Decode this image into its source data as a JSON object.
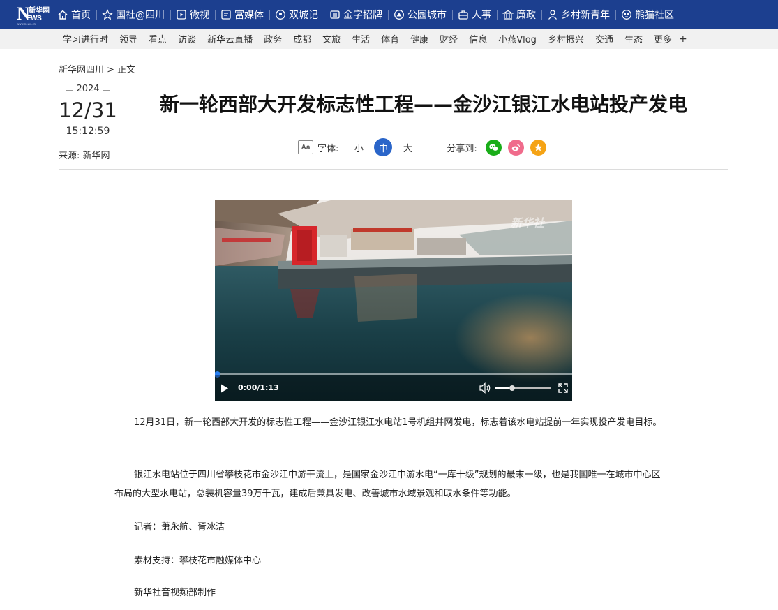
{
  "logo": {
    "main": "N",
    "cn": "新华网",
    "ws": "EWS",
    "small": "www.news.cn"
  },
  "topnav": [
    {
      "label": "首页",
      "icon": "home-icon"
    },
    {
      "label": "国社@四川",
      "icon": "star-badge-icon"
    },
    {
      "label": "微视",
      "icon": "play-square-icon"
    },
    {
      "label": "富媒体",
      "icon": "media-icon"
    },
    {
      "label": "双城记",
      "icon": "location-icon"
    },
    {
      "label": "金字招牌",
      "icon": "signboard-icon"
    },
    {
      "label": "公园城市",
      "icon": "park-icon"
    },
    {
      "label": "人事",
      "icon": "briefcase-icon"
    },
    {
      "label": "廉政",
      "icon": "building-icon"
    },
    {
      "label": "乡村新青年",
      "icon": "person-icon"
    },
    {
      "label": "熊猫社区",
      "icon": "panda-icon"
    }
  ],
  "subnav": [
    "学习进行时",
    "领导",
    "看点",
    "访谈",
    "新华云直播",
    "政务",
    "成都",
    "文旅",
    "生活",
    "体育",
    "健康",
    "财经",
    "信息",
    "小燕Vlog",
    "乡村振兴",
    "交通",
    "生态",
    "更多",
    "+"
  ],
  "breadcrumb": "新华网四川 > 正文",
  "date": {
    "year": "2024",
    "day": "12/31",
    "time": "15:12:59"
  },
  "source": "来源: 新华网",
  "title": "新一轮西部大开发标志性工程——金沙江银江水电站投产发电",
  "tools": {
    "font_label": "字体:",
    "font_icon_text": "Aa",
    "sizes": [
      "小",
      "中",
      "大"
    ],
    "active_size": "中",
    "share_label": "分享到:",
    "share": [
      {
        "name": "wechat-icon",
        "color": "#1aad19"
      },
      {
        "name": "weibo-icon",
        "color": "#f06b8b"
      },
      {
        "name": "qzone-icon",
        "color": "#f5a315"
      }
    ]
  },
  "video": {
    "watermark": "新华社",
    "time": "0:00/1:13",
    "progress": 0,
    "volume": 0.3
  },
  "body": [
    "12月31日，新一轮西部大开发的标志性工程——金沙江银江水电站1号机组并网发电，标志着该水电站提前一年实现投产发电目标。",
    "银江水电站位于四川省攀枝花市金沙江中游干流上，是国家金沙江中游水电“一库十级”规划的最末一级，也是我国唯一在城市中心区布局的大型水电站，总装机容量39万千瓦，建成后兼具发电、改善城市水域景观和取水条件等功能。",
    "记者：萧永航、胥冰洁",
    "素材支持：攀枝花市融媒体中心",
    "新华社音视频部制作"
  ],
  "colors": {
    "nav_bg": "#1c3f8f",
    "subnav_bg": "#f1f1f1",
    "accent": "#2a65c9"
  }
}
